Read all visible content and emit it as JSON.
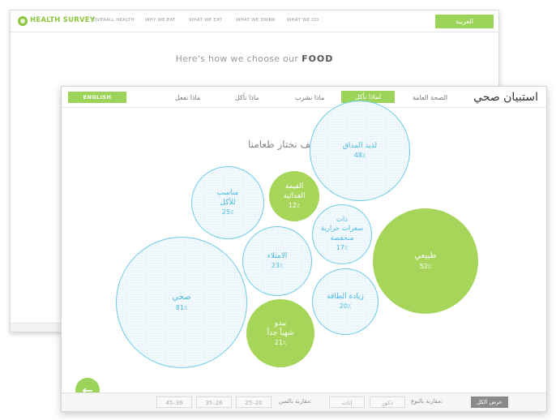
{
  "back_window": {
    "brand": "HEALTH SURVEY",
    "nav": [
      "OVERALL HEALTH",
      "WHY WE EAT",
      "WHAT WE EAT",
      "WHAT WE DRINK",
      "WHAT WE DO"
    ],
    "language_button": "العربية",
    "headline_prefix": "Here's how we choose our ",
    "headline_bold": "FOOD"
  },
  "front_window": {
    "brand": "استبيان صحي",
    "language_button": "ENGLISH",
    "nav": [
      "الصحة العامة",
      "لماذا نأكل",
      "ماذا نشرب",
      "ماذا نأكل",
      "ماذا نفعل"
    ],
    "active_nav": "لماذا نأكل",
    "headline": "كيف نختار طعامنا",
    "bubbles": [
      {
        "label": "لذيذ المذاق",
        "percent": "48٪",
        "style": "outline"
      },
      {
        "label": "القيمة\nالغذائية",
        "percent": "12٪",
        "style": "filled"
      },
      {
        "label": "مناسب\nللأكل",
        "percent": "25٪",
        "style": "outline"
      },
      {
        "label": "ذات\nسعرات حرارية\nمنخفضة",
        "percent": "17٪",
        "style": "outline"
      },
      {
        "label": "طبيعي",
        "percent": "52٪",
        "style": "filled"
      },
      {
        "label": "الامتلاء",
        "percent": "23٪",
        "style": "outline"
      },
      {
        "label": "صحي",
        "percent": "81٪",
        "style": "outline"
      },
      {
        "label": "زيادة الطاقة",
        "percent": "20٪",
        "style": "outline"
      },
      {
        "label": "يبدو\nشهياً جداً",
        "percent": "21٪",
        "style": "filled"
      }
    ],
    "back_button": "←",
    "footer": {
      "show_all": "عرض الكل",
      "compare_gender_label": "مقارنة بالنوع:",
      "gender_options": [
        "ذكور",
        "إناث"
      ],
      "compare_age_label": "مقارنة بالسن:",
      "age_options": [
        "25–20",
        "35–26",
        "45–36"
      ]
    }
  }
}
